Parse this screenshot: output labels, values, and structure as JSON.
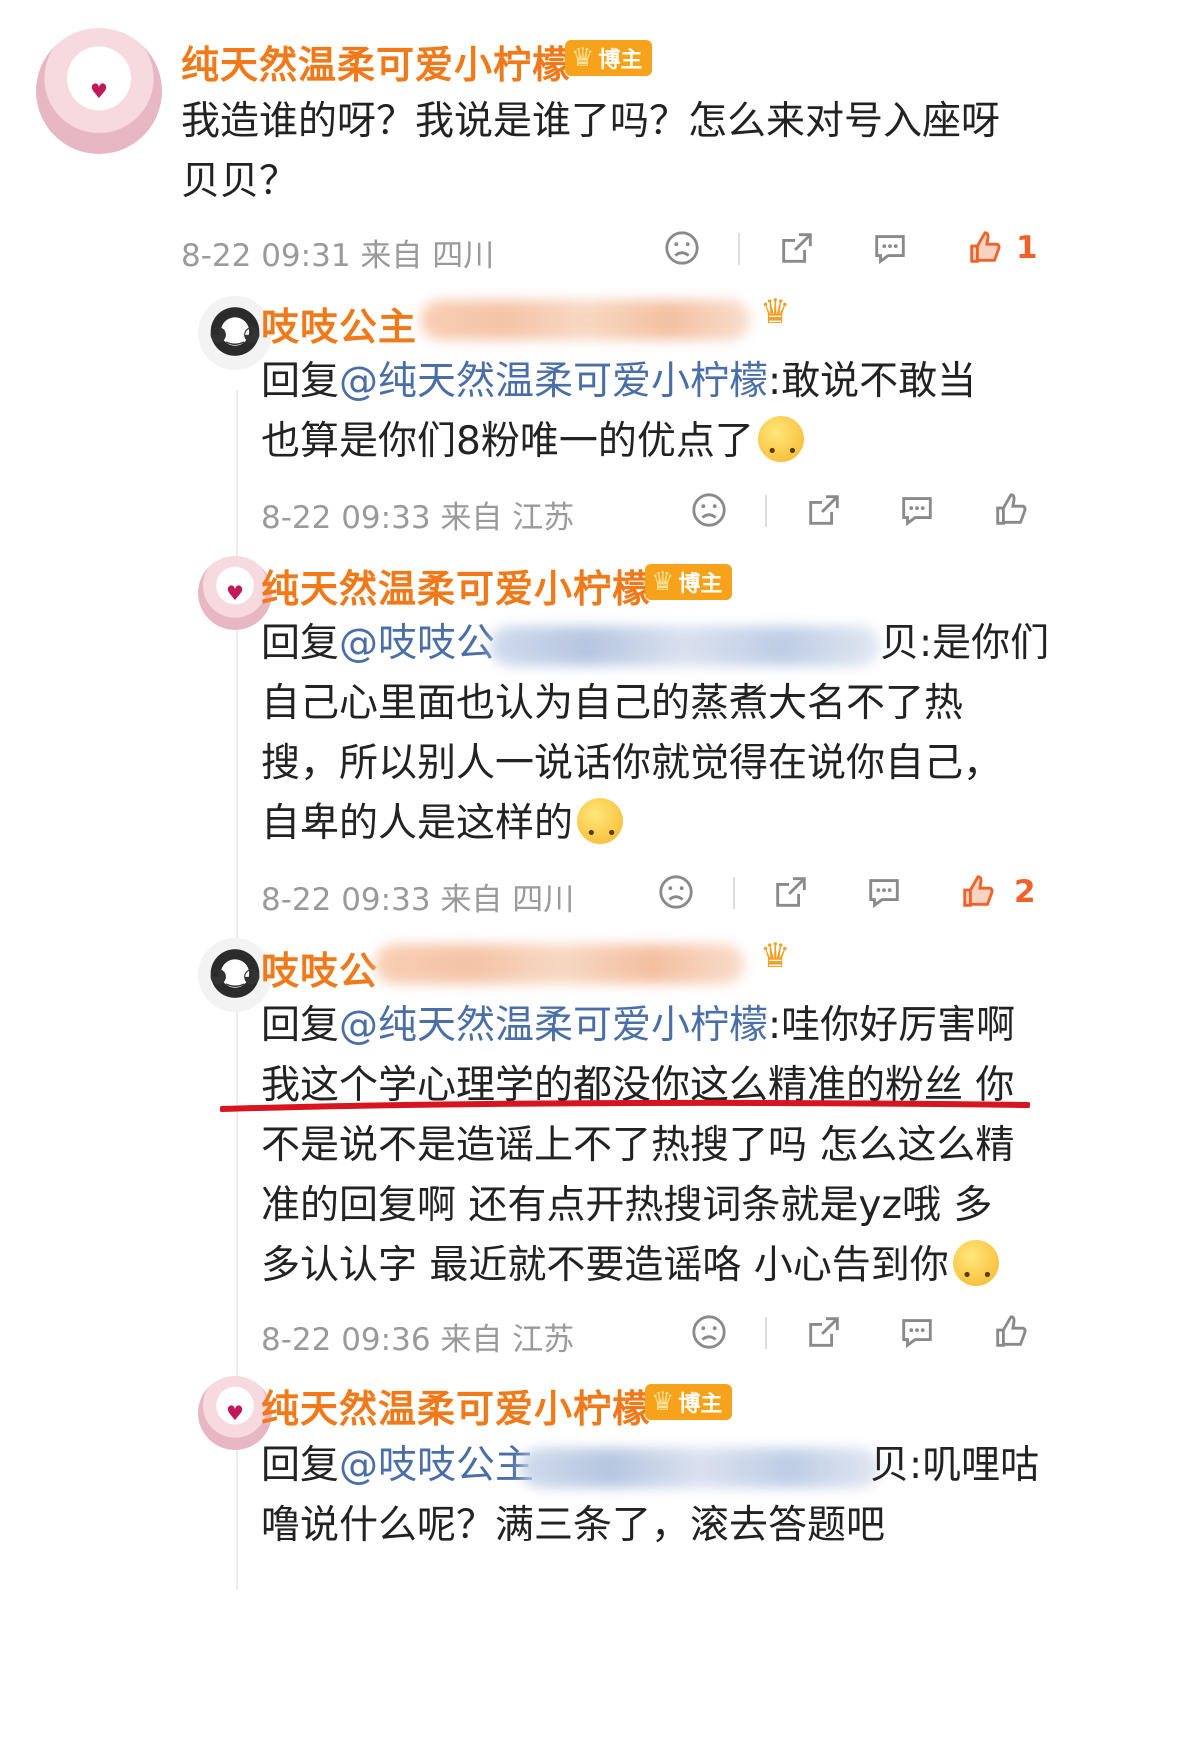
{
  "comments": [
    {
      "user": "纯天然温柔可爱小柠檬",
      "badge": "博主",
      "lines": [
        "我造谁的呀？我说是谁了吗？怎么来对号入座呀",
        "贝贝？"
      ],
      "meta": "8-22 09:31 来自 四川",
      "likes": "1"
    },
    {
      "user": "吱吱公主",
      "reply_prefix": "回复",
      "mention": "@纯天然温柔可爱小柠檬",
      "lines": [
        ":敢说不敢当",
        "也算是你们8粉唯一的优点了"
      ],
      "meta": "8-22 09:33 来自 江苏"
    },
    {
      "user": "纯天然温柔可爱小柠檬",
      "badge": "博主",
      "reply_prefix": "回复",
      "mention": "@吱吱公",
      "lines": [
        "贝:是你们",
        "自己心里面也认为自己的蒸煮大名不了热",
        "搜，所以别人一说话你就觉得在说你自己，",
        "自卑的人是这样的"
      ],
      "meta": "8-22 09:33 来自 四川",
      "likes": "2"
    },
    {
      "user": "吱吱公",
      "reply_prefix": "回复",
      "mention": "@纯天然温柔可爱小柠檬",
      "lines": [
        ":哇你好厉害啊",
        "我这个学心理学的都没你这么精准的粉丝 你",
        "不是说不是造谣上不了热搜了吗 怎么这么精",
        "准的回复啊 还有点开热搜词条就是yz哦 多",
        "多认认字 最近就不要造谣咯 小心告到你"
      ],
      "meta": "8-22 09:36 来自 江苏"
    },
    {
      "user": "纯天然温柔可爱小柠檬",
      "badge": "博主",
      "reply_prefix": "回复",
      "mention": "@吱吱公主",
      "lines": [
        "贝:叽哩咕",
        "噜说什么呢？满三条了，滚去答题吧"
      ]
    }
  ],
  "icons": {
    "dislike": "sad-face-icon",
    "share": "share-icon",
    "comment": "comment-icon",
    "like": "thumbs-up-icon"
  },
  "colors": {
    "username": "#f07a1a",
    "mention": "#4a6fa8",
    "like_active": "#f0622a",
    "meta": "#9a9a9a"
  }
}
